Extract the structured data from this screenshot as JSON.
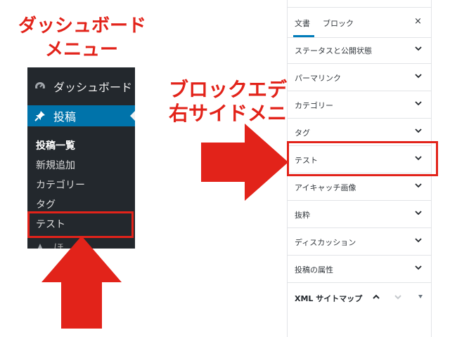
{
  "captions": {
    "dashboard_line1": "ダッシュボード",
    "dashboard_line2": "メニュー",
    "editor_line1": "ブロックエディタ",
    "editor_line2": "右サイドメニュー"
  },
  "admin_menu": {
    "dashboard": "ダッシュボード",
    "posts": "投稿",
    "submenu": [
      "投稿一覧",
      "新規追加",
      "カテゴリー",
      "タグ",
      "テスト"
    ],
    "next_item_partial": "ほ"
  },
  "editor_sidebar": {
    "tabs": [
      "文書",
      "ブロック"
    ],
    "close": "×",
    "panels": [
      "ステータスと公開状態",
      "パーマリンク",
      "カテゴリー",
      "タグ",
      "テスト",
      "アイキャッチ画像",
      "抜粋",
      "ディスカッション",
      "投稿の属性"
    ],
    "sitemap_panel": "XML サイトマップ"
  },
  "colors": {
    "annotation_red": "#e2231a",
    "admin_bg": "#23282d",
    "admin_active": "#0073aa",
    "tab_accent": "#007cba"
  }
}
